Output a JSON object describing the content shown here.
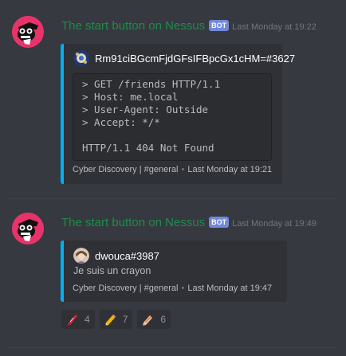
{
  "messages": [
    {
      "author": "The start button on Nessus",
      "bot_tag": "BOT",
      "timestamp": "Last Monday at 19:22",
      "embed": {
        "author_name": "Rm91ciBGcmFjdGFsIFBpcGx1cHM=#3627",
        "code_lines": [
          "> GET /friends HTTP/1.1",
          "> Host: me.local",
          "> User-Agent: Outside",
          "> Accept: */*"
        ],
        "code_result": "HTTP/1.1 404 Not Found",
        "footer_channel": "Cyber Discovery | #general",
        "footer_separator": "•",
        "footer_time": "Last Monday at 19:21",
        "accent_color": "#00b0f4"
      }
    },
    {
      "author": "The start button on Nessus",
      "bot_tag": "BOT",
      "timestamp": "Last Monday at 19:49",
      "embed": {
        "author_name": "dwouca#3987",
        "description": "Je suis un crayon",
        "footer_channel": "Cyber Discovery | #general",
        "footer_separator": "•",
        "footer_time": "Last Monday at 19:47",
        "accent_color": "#00b0f4"
      }
    }
  ],
  "reactions": [
    {
      "icon": "red-crayon-icon",
      "count": "4"
    },
    {
      "icon": "pencil-icon",
      "count": "7"
    },
    {
      "icon": "crayon-icon",
      "count": "6"
    }
  ],
  "colors": {
    "background": "#36393f",
    "author": "#1f8b4c",
    "bot_tag": "#7289da",
    "avatar": "#e8336a",
    "embed_bg": "#2f3136"
  }
}
